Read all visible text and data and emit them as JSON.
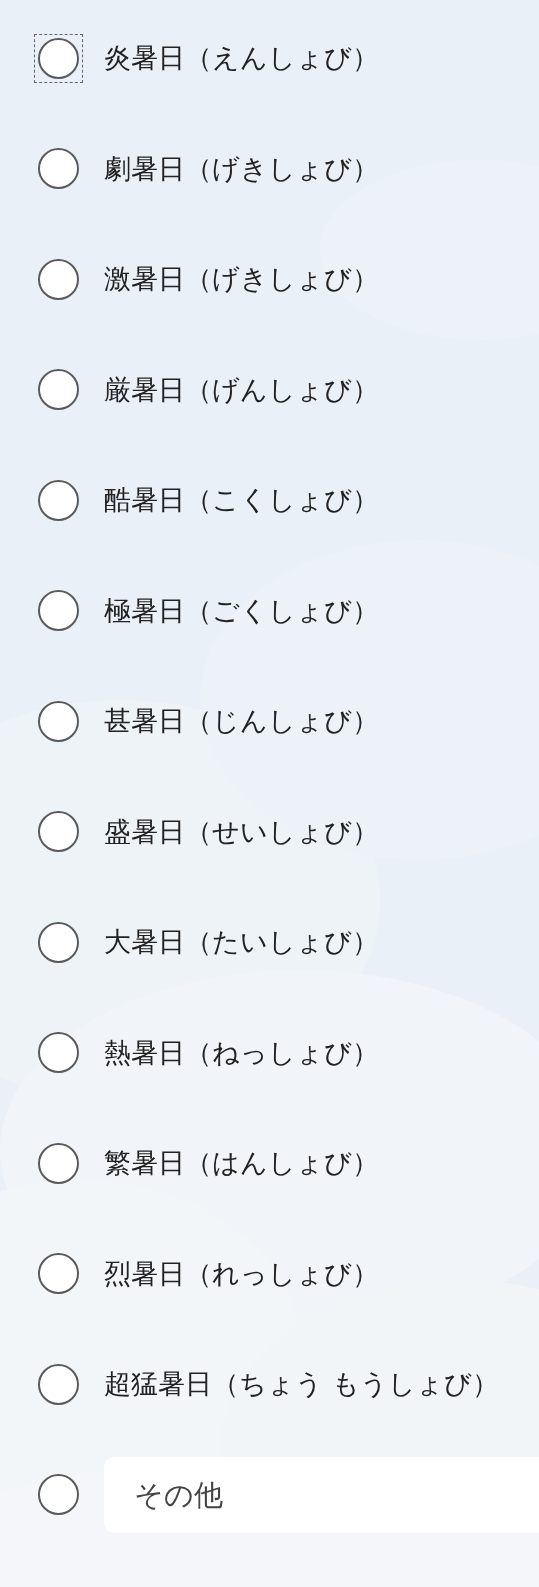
{
  "options": [
    {
      "kind": "choice",
      "label": "炎暑日（えんしょび）",
      "selected": false,
      "focused": true
    },
    {
      "kind": "choice",
      "label": "劇暑日（げきしょび）",
      "selected": false,
      "focused": false
    },
    {
      "kind": "choice",
      "label": "激暑日（げきしょび）",
      "selected": false,
      "focused": false
    },
    {
      "kind": "choice",
      "label": "厳暑日（げんしょび）",
      "selected": false,
      "focused": false
    },
    {
      "kind": "choice",
      "label": "酷暑日（こくしょび）",
      "selected": false,
      "focused": false
    },
    {
      "kind": "choice",
      "label": "極暑日（ごくしょび）",
      "selected": false,
      "focused": false
    },
    {
      "kind": "choice",
      "label": "甚暑日（じんしょび）",
      "selected": false,
      "focused": false
    },
    {
      "kind": "choice",
      "label": "盛暑日（せいしょび）",
      "selected": false,
      "focused": false
    },
    {
      "kind": "choice",
      "label": "大暑日（たいしょび）",
      "selected": false,
      "focused": false
    },
    {
      "kind": "choice",
      "label": "熱暑日（ねっしょび）",
      "selected": false,
      "focused": false
    },
    {
      "kind": "choice",
      "label": "繁暑日（はんしょび）",
      "selected": false,
      "focused": false
    },
    {
      "kind": "choice",
      "label": "烈暑日（れっしょび）",
      "selected": false,
      "focused": false
    },
    {
      "kind": "choice",
      "label": "超猛暑日（ちょう もうしょび）",
      "selected": false,
      "focused": false
    },
    {
      "kind": "other",
      "placeholder": "その他",
      "selected": false,
      "focused": false
    }
  ]
}
